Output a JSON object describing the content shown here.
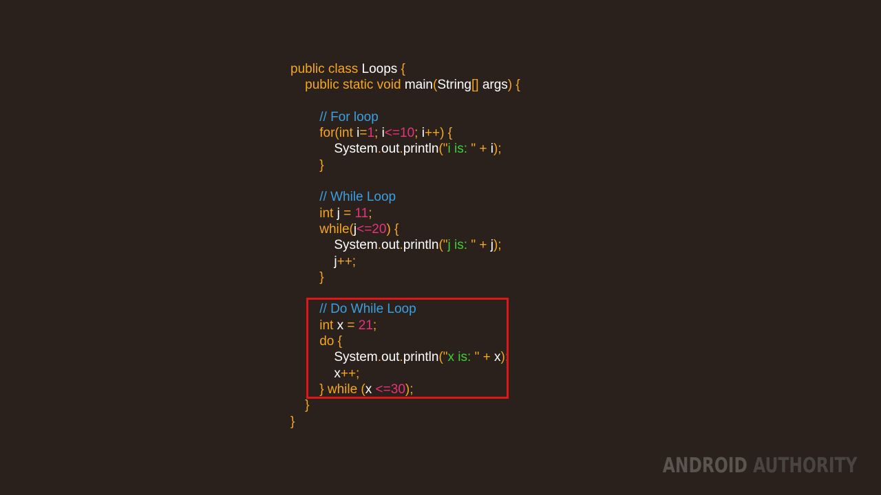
{
  "colors": {
    "background": "#2a211c",
    "keyword": "#f5a623",
    "identifier": "#ffffff",
    "number": "#e8337a",
    "string": "#3fcf36",
    "comment": "#3b9fe0",
    "punctuation": "#f5a623",
    "highlight_border": "#e0161a"
  },
  "code_lines": [
    {
      "indent": "",
      "tokens": [
        {
          "t": "public class ",
          "c": "keyword"
        },
        {
          "t": "Loops",
          "c": "identifier"
        },
        {
          "t": " {",
          "c": "keyword"
        }
      ]
    },
    {
      "indent": "    ",
      "tokens": [
        {
          "t": "public static void ",
          "c": "keyword"
        },
        {
          "t": "main",
          "c": "identifier"
        },
        {
          "t": "(",
          "c": "keyword"
        },
        {
          "t": "String",
          "c": "identifier"
        },
        {
          "t": "[] ",
          "c": "keyword"
        },
        {
          "t": "args",
          "c": "identifier"
        },
        {
          "t": ") {",
          "c": "keyword"
        }
      ]
    },
    {
      "indent": "",
      "tokens": []
    },
    {
      "indent": "        ",
      "tokens": [
        {
          "t": "// For loop",
          "c": "comment"
        }
      ]
    },
    {
      "indent": "        ",
      "tokens": [
        {
          "t": "for(int ",
          "c": "keyword"
        },
        {
          "t": "i",
          "c": "identifier"
        },
        {
          "t": "=",
          "c": "keyword"
        },
        {
          "t": "1",
          "c": "number"
        },
        {
          "t": "; ",
          "c": "keyword"
        },
        {
          "t": "i",
          "c": "identifier"
        },
        {
          "t": "<=",
          "c": "number"
        },
        {
          "t": "10",
          "c": "number"
        },
        {
          "t": "; ",
          "c": "keyword"
        },
        {
          "t": "i",
          "c": "identifier"
        },
        {
          "t": "++) {",
          "c": "keyword"
        }
      ]
    },
    {
      "indent": "            ",
      "tokens": [
        {
          "t": "System",
          "c": "identifier"
        },
        {
          "t": ".",
          "c": "keyword"
        },
        {
          "t": "out",
          "c": "identifier"
        },
        {
          "t": ".",
          "c": "keyword"
        },
        {
          "t": "println",
          "c": "identifier"
        },
        {
          "t": "(\"",
          "c": "keyword"
        },
        {
          "t": "i is: ",
          "c": "string"
        },
        {
          "t": "\" + ",
          "c": "keyword"
        },
        {
          "t": "i",
          "c": "identifier"
        },
        {
          "t": ");",
          "c": "keyword"
        }
      ]
    },
    {
      "indent": "        ",
      "tokens": [
        {
          "t": "}",
          "c": "keyword"
        }
      ]
    },
    {
      "indent": "",
      "tokens": []
    },
    {
      "indent": "        ",
      "tokens": [
        {
          "t": "// While Loop",
          "c": "comment"
        }
      ]
    },
    {
      "indent": "        ",
      "tokens": [
        {
          "t": "int ",
          "c": "keyword"
        },
        {
          "t": "j",
          "c": "identifier"
        },
        {
          "t": " = ",
          "c": "keyword"
        },
        {
          "t": "11",
          "c": "number"
        },
        {
          "t": ";",
          "c": "keyword"
        }
      ]
    },
    {
      "indent": "        ",
      "tokens": [
        {
          "t": "while(",
          "c": "keyword"
        },
        {
          "t": "j",
          "c": "identifier"
        },
        {
          "t": "<=",
          "c": "number"
        },
        {
          "t": "20",
          "c": "number"
        },
        {
          "t": ") {",
          "c": "keyword"
        }
      ]
    },
    {
      "indent": "            ",
      "tokens": [
        {
          "t": "System",
          "c": "identifier"
        },
        {
          "t": ".",
          "c": "keyword"
        },
        {
          "t": "out",
          "c": "identifier"
        },
        {
          "t": ".",
          "c": "keyword"
        },
        {
          "t": "println",
          "c": "identifier"
        },
        {
          "t": "(\"",
          "c": "keyword"
        },
        {
          "t": "j is: ",
          "c": "string"
        },
        {
          "t": "\" + ",
          "c": "keyword"
        },
        {
          "t": "j",
          "c": "identifier"
        },
        {
          "t": ");",
          "c": "keyword"
        }
      ]
    },
    {
      "indent": "            ",
      "tokens": [
        {
          "t": "j",
          "c": "identifier"
        },
        {
          "t": "++;",
          "c": "keyword"
        }
      ]
    },
    {
      "indent": "        ",
      "tokens": [
        {
          "t": "}",
          "c": "keyword"
        }
      ]
    },
    {
      "indent": "",
      "tokens": []
    },
    {
      "indent": "        ",
      "tokens": [
        {
          "t": "// Do While Loop",
          "c": "comment"
        }
      ]
    },
    {
      "indent": "        ",
      "tokens": [
        {
          "t": "int ",
          "c": "keyword"
        },
        {
          "t": "x",
          "c": "identifier"
        },
        {
          "t": " = ",
          "c": "keyword"
        },
        {
          "t": "21",
          "c": "number"
        },
        {
          "t": ";",
          "c": "keyword"
        }
      ]
    },
    {
      "indent": "        ",
      "tokens": [
        {
          "t": "do {",
          "c": "keyword"
        }
      ]
    },
    {
      "indent": "            ",
      "tokens": [
        {
          "t": "System",
          "c": "identifier"
        },
        {
          "t": ".",
          "c": "keyword"
        },
        {
          "t": "out",
          "c": "identifier"
        },
        {
          "t": ".",
          "c": "keyword"
        },
        {
          "t": "println",
          "c": "identifier"
        },
        {
          "t": "(\"",
          "c": "keyword"
        },
        {
          "t": "x is: ",
          "c": "string"
        },
        {
          "t": "\" + ",
          "c": "keyword"
        },
        {
          "t": "x",
          "c": "identifier"
        },
        {
          "t": ");",
          "c": "keyword"
        }
      ]
    },
    {
      "indent": "            ",
      "tokens": [
        {
          "t": "x",
          "c": "identifier"
        },
        {
          "t": "++;",
          "c": "keyword"
        }
      ]
    },
    {
      "indent": "        ",
      "tokens": [
        {
          "t": "} while (",
          "c": "keyword"
        },
        {
          "t": "x",
          "c": "identifier"
        },
        {
          "t": " <=",
          "c": "number"
        },
        {
          "t": "30",
          "c": "number"
        },
        {
          "t": ");",
          "c": "keyword"
        }
      ]
    },
    {
      "indent": "    ",
      "tokens": [
        {
          "t": "}",
          "c": "keyword"
        }
      ]
    },
    {
      "indent": "",
      "tokens": [
        {
          "t": "}",
          "c": "keyword"
        }
      ]
    }
  ],
  "watermark": {
    "part1": "ANDROID",
    "part2": "AUTHORITY"
  }
}
